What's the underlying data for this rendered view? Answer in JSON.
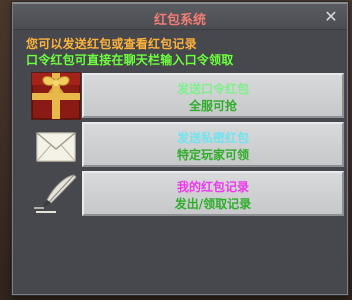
{
  "window": {
    "title": "红包系统",
    "close_label": "✕"
  },
  "intro": {
    "line1": "您可以发送红包或查看红包记录",
    "line2": "口令红包可直接在聊天栏输入口令领取"
  },
  "rows": [
    {
      "title": "发送口令红包",
      "subtitle": "全服可抢",
      "title_color": "#7df08a",
      "icon": "gift-box-icon"
    },
    {
      "title": "发送私密红包",
      "subtitle": "特定玩家可领",
      "title_color": "#6fe4f0",
      "icon": "envelope-icon"
    },
    {
      "title": "我的红包记录",
      "subtitle": "发出/领取记录",
      "title_color": "#ee38ee",
      "icon": "quill-pen-icon"
    }
  ],
  "colors": {
    "title": "#f07c74",
    "intro_line1": "#ffb23a",
    "intro_line2": "#6cff3c",
    "subtitle": "#2fae2a"
  }
}
